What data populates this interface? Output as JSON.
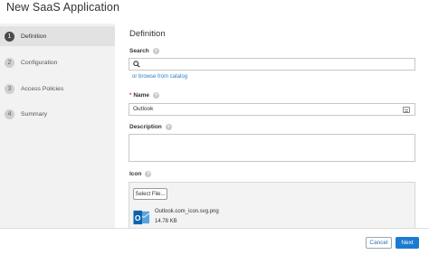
{
  "window": {
    "title": "New SaaS Application"
  },
  "wizard": {
    "steps": [
      {
        "number": "1",
        "label": "Definition",
        "active": true
      },
      {
        "number": "2",
        "label": "Configuration",
        "active": false
      },
      {
        "number": "3",
        "label": "Access Policies",
        "active": false
      },
      {
        "number": "4",
        "label": "Summary",
        "active": false
      }
    ]
  },
  "form": {
    "section_title": "Definition",
    "search": {
      "label": "Search",
      "value": "",
      "help": "?"
    },
    "browse_link": "or browse from catalog",
    "name": {
      "required_mark": "*",
      "label": "Name",
      "value": "Outlook",
      "help": "?"
    },
    "description": {
      "label": "Description",
      "value": "",
      "help": "?"
    },
    "icon": {
      "label": "Icon",
      "help": "?",
      "select_button": "Select File...",
      "file_name": "Outlook.com_icon.svg.png",
      "file_size": "14.78 KB",
      "tile_letter": "O"
    }
  },
  "footer": {
    "cancel_label": "Cancel",
    "next_label": "Next"
  },
  "colors": {
    "accent": "#1b7bd0",
    "link": "#2d7fc1",
    "required": "#d9342b",
    "outlook_blue": "#0a64ad"
  }
}
